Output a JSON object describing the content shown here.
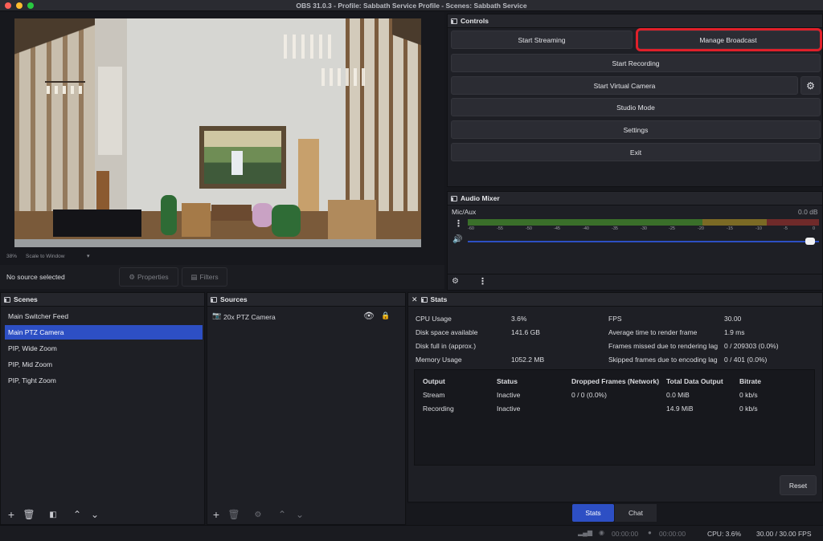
{
  "window": {
    "title": "OBS 31.0.3 - Profile: Sabbath Service Profile - Scenes: Sabbath Service"
  },
  "preview": {
    "zoom": "38%",
    "scale_mode": "Scale to Window"
  },
  "source_bar": {
    "status": "No source selected",
    "properties_label": "Properties",
    "filters_label": "Filters"
  },
  "controls": {
    "title": "Controls",
    "start_streaming": "Start Streaming",
    "manage_broadcast": "Manage Broadcast",
    "start_recording": "Start Recording",
    "start_virtual_camera": "Start Virtual Camera",
    "studio_mode": "Studio Mode",
    "settings": "Settings",
    "exit": "Exit",
    "highlight_color": "#e0202a"
  },
  "audio_mixer": {
    "title": "Audio Mixer",
    "channel": "Mic/Aux",
    "level": "0.0 dB",
    "ticks": [
      "-60",
      "-55",
      "-50",
      "-45",
      "-40",
      "-35",
      "-30",
      "-25",
      "-20",
      "-15",
      "-10",
      "-5",
      "0"
    ],
    "volume_fraction": 0.98
  },
  "scenes": {
    "title": "Scenes",
    "items": [
      "Main Switcher Feed",
      "Main PTZ Camera",
      "PIP, Wide Zoom",
      "PIP, Mid Zoom",
      "PIP, Tight Zoom"
    ],
    "selected_index": 1
  },
  "sources": {
    "title": "Sources",
    "items": [
      {
        "name": "20x PTZ Camera"
      }
    ]
  },
  "stats": {
    "title": "Stats",
    "left": [
      {
        "label": "CPU Usage",
        "value": "3.6%"
      },
      {
        "label": "Disk space available",
        "value": "141.6 GB"
      },
      {
        "label": "Disk full in (approx.)",
        "value": ""
      },
      {
        "label": "Memory Usage",
        "value": "1052.2 MB"
      }
    ],
    "right": [
      {
        "label": "FPS",
        "value": "30.00"
      },
      {
        "label": "Average time to render frame",
        "value": "1.9 ms"
      },
      {
        "label": "Frames missed due to rendering lag",
        "value": "0 / 209303 (0.0%)"
      },
      {
        "label": "Skipped frames due to encoding lag",
        "value": "0 / 401 (0.0%)"
      }
    ],
    "table": {
      "headers": [
        "Output",
        "Status",
        "Dropped Frames (Network)",
        "Total Data Output",
        "Bitrate"
      ],
      "rows": [
        [
          "Stream",
          "Inactive",
          "0 / 0 (0.0%)",
          "0.0 MiB",
          "0 kb/s"
        ],
        [
          "Recording",
          "Inactive",
          "",
          "14.9 MiB",
          "0 kb/s"
        ]
      ]
    },
    "reset_label": "Reset"
  },
  "bottom_tabs": {
    "stats": "Stats",
    "chat": "Chat"
  },
  "status_bar": {
    "stream_time": "00:00:00",
    "rec_time": "00:00:00",
    "cpu": "CPU: 3.6%",
    "fps": "30.00 / 30.00 FPS"
  }
}
